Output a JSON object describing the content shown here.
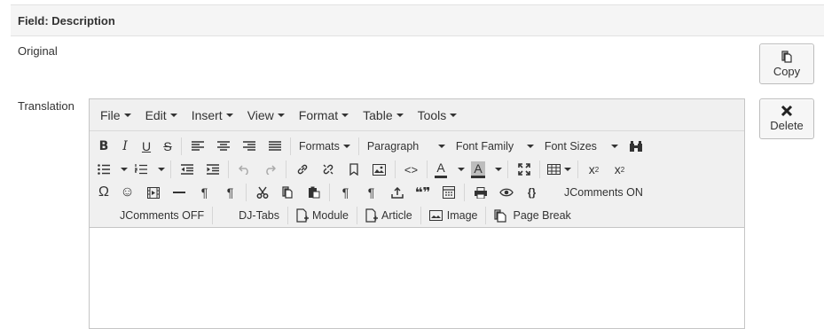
{
  "field": {
    "title": "Field: Description"
  },
  "labels": {
    "original": "Original",
    "translation": "Translation"
  },
  "buttons": {
    "copy": "Copy",
    "delete": "Delete"
  },
  "menubar": [
    "File",
    "Edit",
    "Insert",
    "View",
    "Format",
    "Table",
    "Tools"
  ],
  "toolbar": {
    "formats": "Formats",
    "paragraph": "Paragraph",
    "font_family": "Font Family",
    "font_sizes": "Font Sizes",
    "jcomments_on": "JComments ON",
    "jcomments_off": "JComments OFF",
    "dj_tabs": "DJ-Tabs",
    "module": "Module",
    "article": "Article",
    "image": "Image",
    "page_break": "Page Break",
    "symbols": {
      "bold": "B",
      "italic": "I",
      "underline": "U",
      "strike": "S",
      "omega": "Ω",
      "smiley": "☺",
      "subscript_base": "x",
      "subscript": "2",
      "superscript_base": "x",
      "superscript": "2",
      "text_color": "A",
      "bg_color": "A",
      "pilcrow": "¶",
      "pilcrow_rtl": "¶",
      "code": "<>",
      "quote": "❝❞",
      "code_braces": "{}"
    }
  }
}
